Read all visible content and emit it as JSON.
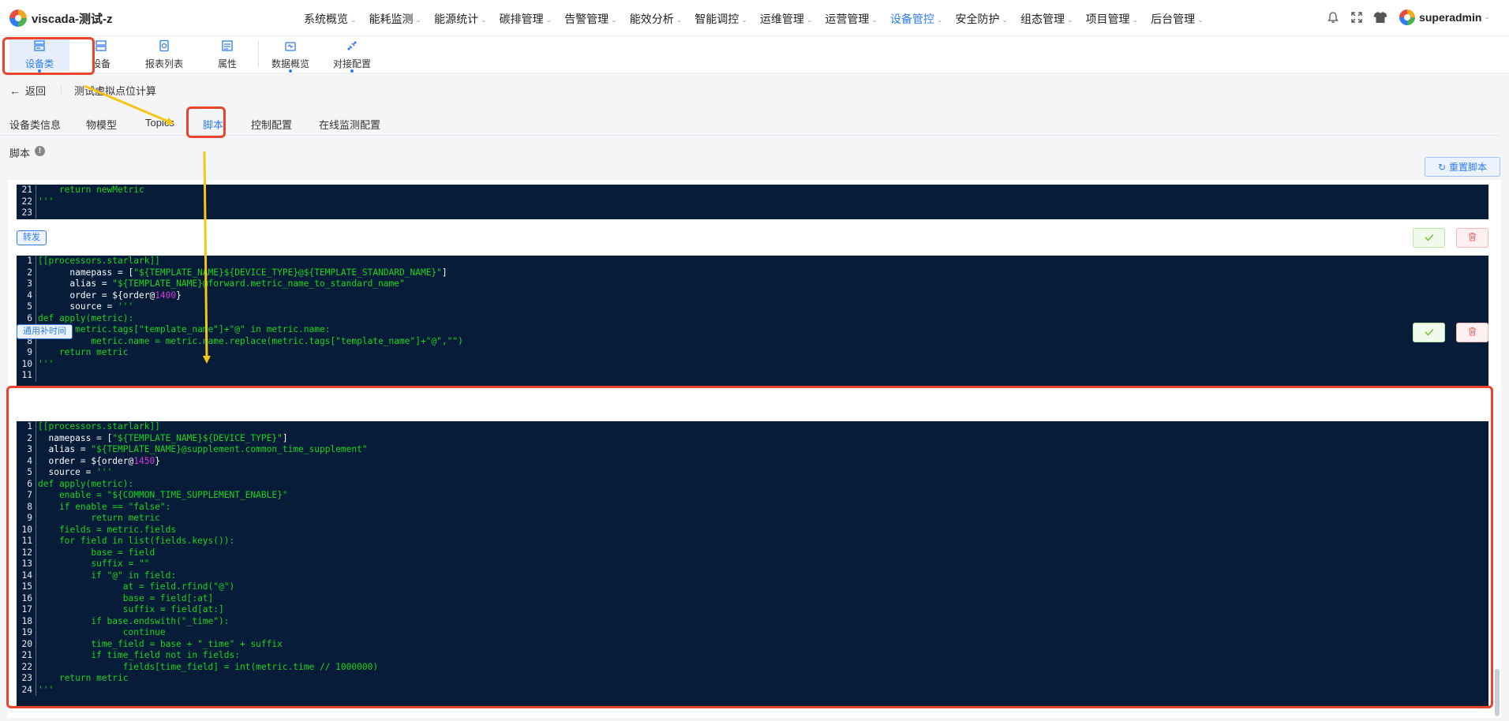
{
  "app": {
    "title": "viscada-测试-z"
  },
  "nav": {
    "items": [
      "系统概览",
      "能耗监测",
      "能源统计",
      "碳排管理",
      "告警管理",
      "能效分析",
      "智能调控",
      "运维管理",
      "运营管理",
      "设备管控",
      "安全防护",
      "组态管理",
      "项目管理",
      "后台管理"
    ],
    "active_index": 9
  },
  "user": {
    "name": "superadmin"
  },
  "subtoolbar": {
    "items": [
      {
        "label": "设备类",
        "icon": "device-class-icon",
        "active": true
      },
      {
        "label": "设备",
        "icon": "device-icon",
        "active": false
      },
      {
        "label": "报表列表",
        "icon": "report-list-icon",
        "active": false
      },
      {
        "label": "属性",
        "icon": "attribute-icon",
        "active": false
      },
      {
        "label": "数据概览",
        "icon": "data-overview-icon",
        "active": false
      },
      {
        "label": "对接配置",
        "icon": "integration-config-icon",
        "active": false
      }
    ]
  },
  "breadcrumb": {
    "back_label": "返回",
    "device_name": "测试虚拟点位计算"
  },
  "tabs": {
    "items": [
      "设备类信息",
      "物模型",
      "Topics",
      "脚本",
      "控制配置",
      "在线监测配置"
    ],
    "active_index": 3
  },
  "script_section": {
    "label": "脚本",
    "reset_label": "重置脚本"
  },
  "blocks": [
    {
      "label": "",
      "lines": [
        {
          "n": "21",
          "segs": [
            [
              "    return newMetric",
              "str"
            ]
          ]
        },
        {
          "n": "22",
          "segs": [
            [
              "'''",
              "str"
            ]
          ]
        },
        {
          "n": "23",
          "segs": [
            [
              "",
              "str"
            ]
          ]
        }
      ]
    },
    {
      "label": "转发",
      "lines": [
        {
          "n": "1",
          "segs": [
            [
              "[[processors.starlark]]",
              "str"
            ]
          ]
        },
        {
          "n": "2",
          "segs": [
            [
              "      namepass = [",
              "plain"
            ],
            [
              "\"${TEMPLATE_NAME}${DEVICE_TYPE}@${TEMPLATE_STANDARD_NAME}\"",
              "str"
            ],
            [
              "]",
              "plain"
            ]
          ]
        },
        {
          "n": "3",
          "segs": [
            [
              "      alias = ",
              "plain"
            ],
            [
              "\"${TEMPLATE_NAME}@forward.metric_name_to_standard_name\"",
              "str"
            ]
          ]
        },
        {
          "n": "4",
          "segs": [
            [
              "      order = ${order@",
              "plain"
            ],
            [
              "1400",
              "num"
            ],
            [
              "}",
              "plain"
            ]
          ]
        },
        {
          "n": "5",
          "segs": [
            [
              "      source = ",
              "plain"
            ],
            [
              "'''",
              "str"
            ]
          ]
        },
        {
          "n": "6",
          "segs": [
            [
              "def apply(metric):",
              "str"
            ]
          ]
        },
        {
          "n": "7",
          "segs": [
            [
              "    if metric.tags[\"template_name\"]+\"@\" in metric.name:",
              "str"
            ]
          ]
        },
        {
          "n": "8",
          "segs": [
            [
              "          metric.name = metric.name.replace(metric.tags[\"template_name\"]+\"@\",\"\")",
              "str"
            ]
          ]
        },
        {
          "n": "9",
          "segs": [
            [
              "    return metric",
              "str"
            ]
          ]
        },
        {
          "n": "10",
          "segs": [
            [
              "'''",
              "str"
            ]
          ]
        },
        {
          "n": "11",
          "segs": [
            [
              "",
              "str"
            ]
          ]
        }
      ]
    },
    {
      "label": "通用补时间",
      "lines": [
        {
          "n": "1",
          "segs": [
            [
              "[[processors.starlark]]",
              "str"
            ]
          ]
        },
        {
          "n": "2",
          "segs": [
            [
              "  namepass = [",
              "plain"
            ],
            [
              "\"${TEMPLATE_NAME}${DEVICE_TYPE}\"",
              "str"
            ],
            [
              "]",
              "plain"
            ]
          ]
        },
        {
          "n": "3",
          "segs": [
            [
              "  alias = ",
              "plain"
            ],
            [
              "\"${TEMPLATE_NAME}@supplement.common_time_supplement\"",
              "str"
            ]
          ]
        },
        {
          "n": "4",
          "segs": [
            [
              "  order = ${order@",
              "plain"
            ],
            [
              "1450",
              "num"
            ],
            [
              "}",
              "plain"
            ]
          ]
        },
        {
          "n": "5",
          "segs": [
            [
              "  source = ",
              "plain"
            ],
            [
              "'''",
              "str"
            ]
          ]
        },
        {
          "n": "6",
          "segs": [
            [
              "def apply(metric):",
              "str"
            ]
          ]
        },
        {
          "n": "7",
          "segs": [
            [
              "    enable = \"${COMMON_TIME_SUPPLEMENT_ENABLE}\"",
              "str"
            ]
          ]
        },
        {
          "n": "8",
          "segs": [
            [
              "    if enable == \"false\":",
              "str"
            ]
          ]
        },
        {
          "n": "9",
          "segs": [
            [
              "          return metric",
              "str"
            ]
          ]
        },
        {
          "n": "10",
          "segs": [
            [
              "    fields = metric.fields",
              "str"
            ]
          ]
        },
        {
          "n": "11",
          "segs": [
            [
              "    for field in list(fields.keys()):",
              "str"
            ]
          ]
        },
        {
          "n": "12",
          "segs": [
            [
              "          base = field",
              "str"
            ]
          ]
        },
        {
          "n": "13",
          "segs": [
            [
              "          suffix = \"\"",
              "str"
            ]
          ]
        },
        {
          "n": "14",
          "segs": [
            [
              "          if \"@\" in field:",
              "str"
            ]
          ]
        },
        {
          "n": "15",
          "segs": [
            [
              "                at = field.rfind(\"@\")",
              "str"
            ]
          ]
        },
        {
          "n": "16",
          "segs": [
            [
              "                base = field[:at]",
              "str"
            ]
          ]
        },
        {
          "n": "17",
          "segs": [
            [
              "                suffix = field[at:]",
              "str"
            ]
          ]
        },
        {
          "n": "18",
          "segs": [
            [
              "          if base.endswith(\"_time\"):",
              "str"
            ]
          ]
        },
        {
          "n": "19",
          "segs": [
            [
              "                continue",
              "str"
            ]
          ]
        },
        {
          "n": "20",
          "segs": [
            [
              "          time_field = base + \"_time\" + suffix",
              "str"
            ]
          ]
        },
        {
          "n": "21",
          "segs": [
            [
              "          if time_field not in fields:",
              "str"
            ]
          ]
        },
        {
          "n": "22",
          "segs": [
            [
              "                fields[time_field] = int(metric.time // 1000000)",
              "str"
            ]
          ]
        },
        {
          "n": "23",
          "segs": [
            [
              "    return metric",
              "str"
            ]
          ]
        },
        {
          "n": "24",
          "segs": [
            [
              "'''",
              "str"
            ]
          ]
        }
      ]
    }
  ],
  "colors": {
    "accent": "#2f7cf6",
    "annotation": "#e8452c",
    "arrow": "#f5c518",
    "code_bg": "#061c38",
    "code_text": "#1bd420"
  }
}
